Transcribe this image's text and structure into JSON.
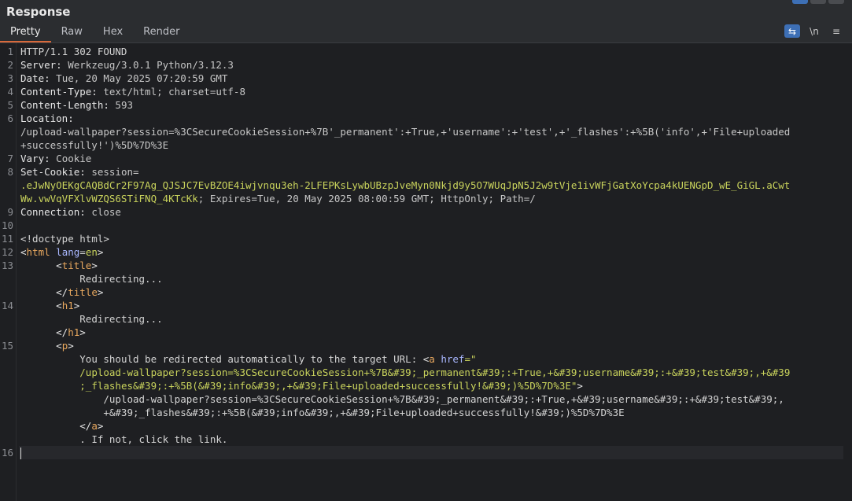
{
  "panel": {
    "title": "Response"
  },
  "tabs": [
    "Pretty",
    "Raw",
    "Hex",
    "Render"
  ],
  "tools": {
    "wrap": "⇆",
    "newline": "\\n",
    "menu": "≡"
  },
  "lines": [
    {
      "n": "1",
      "t": "HTTP/1.1 302 FOUND"
    },
    {
      "n": "2",
      "k": "Server:",
      "v": " Werkzeug/3.0.1 Python/3.12.3"
    },
    {
      "n": "3",
      "k": "Date:",
      "v": " Tue, 20 May 2025 07:20:59 GMT"
    },
    {
      "n": "4",
      "k": "Content-Type:",
      "v": " text/html; charset=utf-8"
    },
    {
      "n": "5",
      "k": "Content-Length:",
      "v": " 593"
    },
    {
      "n": "6",
      "k": "Location:",
      "v": ""
    },
    {
      "n": "",
      "v": "/upload-wallpaper?session=%3CSecureCookieSession+%7B'_permanent':+True,+'username':+'test',+'_flashes':+%5B('info',+'File+uploaded"
    },
    {
      "n": "",
      "v": "+successfully!')%5D%7D%3E"
    },
    {
      "n": "7",
      "k": "Vary:",
      "v": " Cookie"
    },
    {
      "n": "8",
      "k": "Set-Cookie:",
      "v": " session="
    },
    {
      "n": "",
      "s": ".eJwNyOEKgCAQBdCr2F97Ag_QJSJC7EvBZOE4iwjvnqu3eh-2LFEPKsLywbUBzpJveMyn0Nkjd9y5O7WUqJpN5J2w9tVje1ivWFjGatXoYcpa4kUENGpD_wE_GiGL.aCwt"
    },
    {
      "n": "",
      "s": "Ww.vwVqVFXlvWZQS6STiFNQ_4KTcKk",
      "v": "; Expires=Tue, 20 May 2025 08:00:59 GMT; HttpOnly; Path=/"
    },
    {
      "n": "9",
      "k": "Connection:",
      "v": " close"
    },
    {
      "n": "10",
      "t": ""
    },
    {
      "n": "11",
      "t": "<!doctype html>"
    },
    {
      "n": "12",
      "h": "html"
    },
    {
      "n": "13",
      "i": "      ",
      "o": "title"
    },
    {
      "n": "",
      "i": "          ",
      "t": "Redirecting..."
    },
    {
      "n": "",
      "i": "      ",
      "c": "title"
    },
    {
      "n": "14",
      "i": "      ",
      "o": "h1"
    },
    {
      "n": "",
      "i": "          ",
      "t": "Redirecting..."
    },
    {
      "n": "",
      "i": "      ",
      "c": "h1"
    },
    {
      "n": "15",
      "i": "      ",
      "o": "p"
    },
    {
      "n": "",
      "i": "          ",
      "t": "You should be redirected automatically to the target URL: ",
      "a": "a"
    },
    {
      "n": "",
      "i": "          ",
      "s": "/upload-wallpaper?session=%3CSecureCookieSession+%7B&#39;_permanent&#39;:+True,+&#39;username&#39;:+&#39;test&#39;,+&#39"
    },
    {
      "n": "",
      "i": "          ",
      "s": ";_flashes&#39;:+%5B(&#39;info&#39;,+&#39;File+uploaded+successfully!&#39;)%5D%7D%3E\"",
      "e": ">"
    },
    {
      "n": "",
      "i": "              ",
      "t": "/upload-wallpaper?session=%3CSecureCookieSession+%7B&#39;_permanent&#39;:+True,+&#39;username&#39;:+&#39;test&#39;,"
    },
    {
      "n": "",
      "i": "              ",
      "t": "+&#39;_flashes&#39;:+%5B(&#39;info&#39;,+&#39;File+uploaded+successfully!&#39;)%5D%7D%3E"
    },
    {
      "n": "",
      "i": "          ",
      "c": "a"
    },
    {
      "n": "",
      "i": "          ",
      "t": ". If not, click the link."
    },
    {
      "n": "16",
      "t": "",
      "cur": true
    }
  ],
  "html_attr": {
    "name": "lang",
    "value": "en"
  },
  "a_attr": {
    "name": "href",
    "open": "=\""
  }
}
